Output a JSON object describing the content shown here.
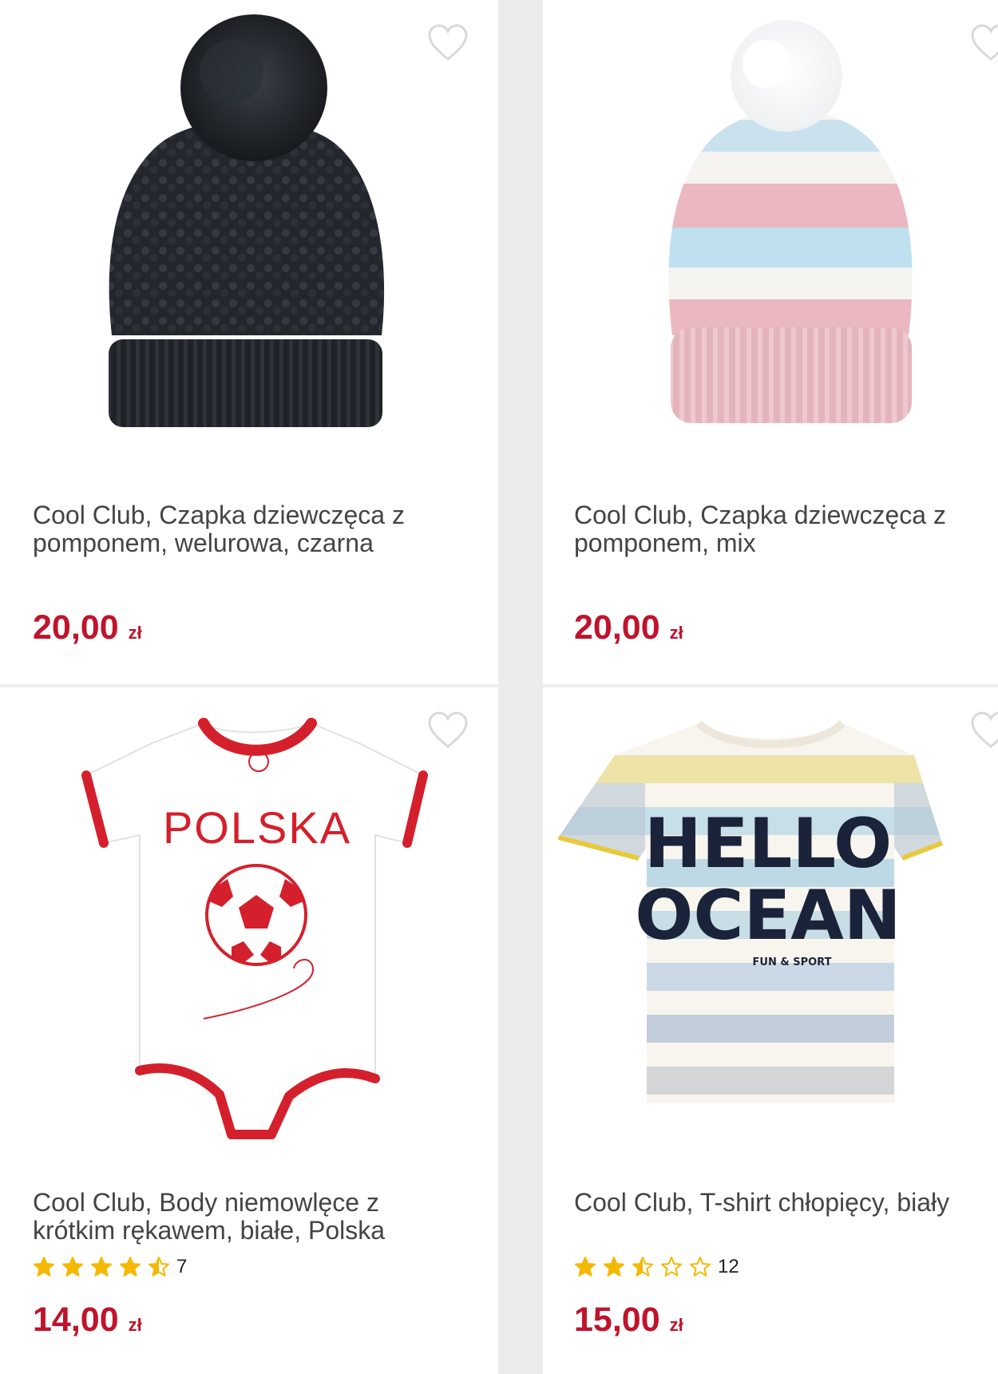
{
  "colors": {
    "price": "#c0142c",
    "title": "#444444",
    "star": "#f5b800",
    "background": "#ececec"
  },
  "products": [
    {
      "name": "Cool Club, Czapka dziewczęca z pomponem, welurowa, czarna",
      "price": "20,00",
      "currency": "zł",
      "rating_stars": null,
      "rating_count": null,
      "image": "black-knit-pompom-hat",
      "favorite_icon": "heart-outline-icon"
    },
    {
      "name": "Cool Club, Czapka dziewczęca z pomponem, mix",
      "price": "20,00",
      "currency": "zł",
      "rating_stars": null,
      "rating_count": null,
      "image": "pastel-striped-pompom-hat",
      "favorite_icon": "heart-outline-icon"
    },
    {
      "name": "Cool Club, Body niemowlęce z krótkim rękawem, białe, Polska",
      "price": "14,00",
      "currency": "zł",
      "rating_stars": 4.5,
      "rating_count": "7",
      "image": "white-red-polska-bodysuit",
      "print_text": "POLSKA",
      "favorite_icon": "heart-outline-icon"
    },
    {
      "name": "Cool Club, T-shirt chłopięcy, biały",
      "price": "15,00",
      "currency": "zł",
      "rating_stars": 2.5,
      "rating_count": "12",
      "image": "striped-hello-ocean-tshirt",
      "print_text_1": "HELLO",
      "print_text_2": "OCEAN",
      "print_text_3": "FUN & SPORT",
      "favorite_icon": "heart-outline-icon"
    }
  ]
}
